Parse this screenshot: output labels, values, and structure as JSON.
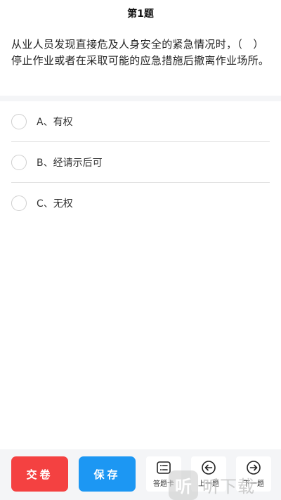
{
  "header": {
    "title": "第1题"
  },
  "question": {
    "text": "从业人员发现直接危及人身安全的紧急情况时，（　）停止作业或者在采取可能的应急措施后撤离作业场所。"
  },
  "options": [
    {
      "label": "A、有权"
    },
    {
      "label": "B、经请示后可"
    },
    {
      "label": "C、无权"
    }
  ],
  "footer": {
    "submit_label": "交卷",
    "save_label": "保存",
    "answer_card_label": "答题卡",
    "prev_label": "上一题",
    "next_label": "下一题"
  },
  "watermark": {
    "logo_char": "听",
    "text": "听下载"
  },
  "colors": {
    "submit": "#f44141",
    "save": "#1c97f3",
    "footer_bg": "#f4f5f7"
  },
  "icons": {
    "answer_card": "list-icon",
    "prev": "arrow-left-circle-icon",
    "next": "arrow-right-circle-icon"
  }
}
